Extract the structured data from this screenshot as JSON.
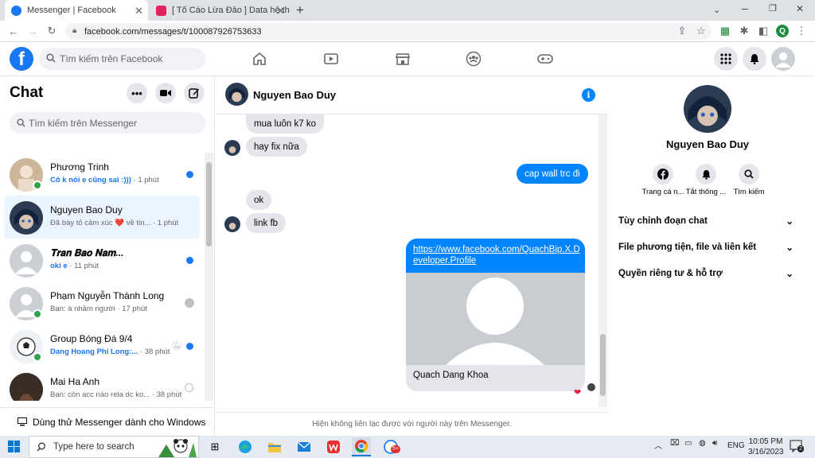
{
  "browser": {
    "tabs": [
      {
        "title": "Messenger | Facebook"
      },
      {
        "title": "[ Tố Cáo Lừa Đảo ] Data hệ thống"
      }
    ],
    "new_tab": "+",
    "url": "facebook.com/messages/t/100087926753633",
    "profile_initial": "Q"
  },
  "fb": {
    "logo": "f",
    "search_placeholder": "Tìm kiếm trên Facebook"
  },
  "left": {
    "title": "Chat",
    "more": "•••",
    "search_placeholder": "Tìm kiếm trên Messenger",
    "conversations": [
      {
        "name": "Phương Trinh",
        "preview": "Cô k nói e cũng sai :)))",
        "time": "· 1 phút",
        "unread": true,
        "online": true
      },
      {
        "name": "Nguyen Bao Duy",
        "preview": "Đã bày tỏ cảm xúc ❤️ về tin...",
        "time": "· 1 phút",
        "unread": false,
        "online": false
      },
      {
        "name": "𝐓𝐫𝐚𝐧 𝐁𝐚𝐨 𝐍𝐚𝐦...",
        "preview": "oki e",
        "time": "· 11 phút",
        "unread": true,
        "online": false
      },
      {
        "name": "Phạm Nguyễn Thành Long",
        "preview": "Bạn: à nhầm người",
        "time": "· 17 phút",
        "unread": false,
        "online": true
      },
      {
        "name": "Group Bóng Đá 9/4",
        "preview": "Dang Hoang Phi Long:...",
        "time": "· 38 phút",
        "unread": true,
        "online": true
      },
      {
        "name": "Mai Ha Anh",
        "preview": "Bạn: còn acc nào rela dc ko...",
        "time": "· 38 phút",
        "unread": false,
        "online": false
      }
    ],
    "windows_promo": "Dùng thử Messenger dành cho Windows"
  },
  "chat": {
    "name": "Nguyen Bao Duy",
    "messages": [
      {
        "text": "mua luôn k7 ko"
      },
      {
        "text": "hay fix nữa"
      },
      {
        "text": "cap wall trc đi"
      },
      {
        "text": "ok"
      },
      {
        "text": "link fb"
      },
      {
        "text": "https://www.facebook.com/QuachBip.X.Developer.Profile",
        "line1": "https://www.facebook.com/QuachBip.X.D",
        "line2": "eveloper.Profile"
      }
    ],
    "link_card_title": "Quach Dang Khoa",
    "reaction": "❤",
    "footer": "Hiện không liên lạc được với người này trên Messenger."
  },
  "right": {
    "name": "Nguyen Bao Duy",
    "actions": [
      "Trang cá n...",
      "Tắt thông ...",
      "Tìm kiếm"
    ],
    "sections": [
      "Tùy chỉnh đoạn chat",
      "File phương tiện, file và liên kết",
      "Quyền riêng tư & hỗ trợ"
    ]
  },
  "taskbar": {
    "search_placeholder": "Type here to search",
    "lang": "ENG",
    "time": "10:05 PM",
    "date": "3/16/2023",
    "notif_count": "2",
    "badge": "5+"
  }
}
